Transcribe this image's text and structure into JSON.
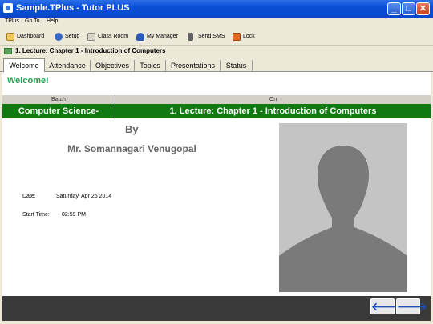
{
  "window": {
    "title": "Sample.TPlus - Tutor PLUS",
    "controls": {
      "minimize": "_",
      "maximize": "□",
      "close": "✕"
    }
  },
  "menu": {
    "items": [
      "TPlus",
      "Go To",
      "Help"
    ]
  },
  "toolbar": {
    "items": [
      {
        "label": "Dashboard",
        "icon": "home-icon"
      },
      {
        "label": "Setup",
        "icon": "setup-icon"
      },
      {
        "label": "Class Room",
        "icon": "classroom-icon"
      },
      {
        "label": "My Manager",
        "icon": "user-icon"
      },
      {
        "label": "Send SMS",
        "icon": "phone-icon"
      },
      {
        "label": "Lock",
        "icon": "lock-icon"
      }
    ]
  },
  "lecture": {
    "title": "1. Lecture: Chapter 1 - Introduction of Computers"
  },
  "tabs": [
    "Welcome",
    "Attendance",
    "Objectives",
    "Topics",
    "Presentations",
    "Status"
  ],
  "active_tab": "Welcome",
  "welcome": {
    "heading": "Welcome!",
    "batch_header": "Batch",
    "on_header": "On",
    "batch_value": "Computer Science-",
    "on_value": "1. Lecture: Chapter 1 - Introduction of Computers",
    "by_label": "By",
    "teacher": "Mr. Somannagari Venugopal",
    "date_label": "Date:",
    "date_value": "Saturday, Apr 26 2014",
    "start_label": "Start Time:",
    "start_value": "02:59 PM"
  },
  "footer": {
    "prev": "🡐",
    "next": "🡒"
  },
  "colors": {
    "accent_green": "#107a10",
    "welcome_green": "#1ea050",
    "titlebar_blue": "#0a4fd8"
  }
}
